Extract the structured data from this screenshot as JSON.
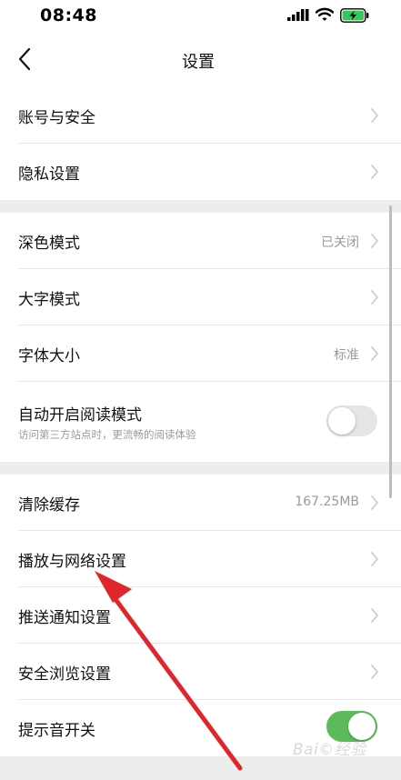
{
  "status_bar": {
    "time": "08:48"
  },
  "nav": {
    "title": "设置"
  },
  "rows": {
    "account": {
      "label": "账号与安全"
    },
    "privacy": {
      "label": "隐私设置"
    },
    "dark_mode": {
      "label": "深色模式",
      "value": "已关闭"
    },
    "large_text": {
      "label": "大字模式"
    },
    "font_size": {
      "label": "字体大小",
      "value": "标准"
    },
    "reader_mode": {
      "label": "自动开启阅读模式",
      "subtitle": "访问第三方站点时，更流畅的阅读体验",
      "enabled": false
    },
    "clear_cache": {
      "label": "清除缓存",
      "value": "167.25MB"
    },
    "playback_network": {
      "label": "播放与网络设置"
    },
    "push_notify": {
      "label": "推送通知设置"
    },
    "safe_browse": {
      "label": "安全浏览设置"
    },
    "alert_sound": {
      "label": "提示音开关",
      "enabled": true
    }
  },
  "watermark": {
    "text": "Bai©经验"
  },
  "colors": {
    "toggle_on": "#5bbb5b",
    "toggle_off": "#e5e5e5",
    "annotation_arrow": "#e0262b",
    "background": "#ededed"
  }
}
